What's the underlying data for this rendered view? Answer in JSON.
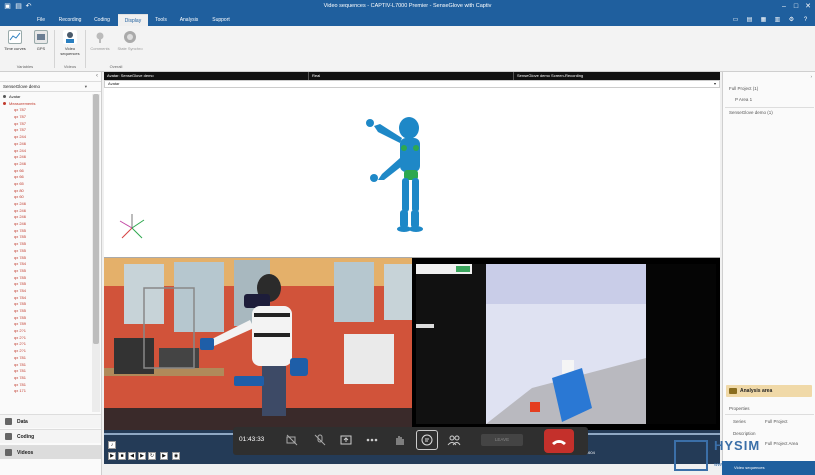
{
  "window": {
    "title": "Video sequences - CAPTIV-L7000 Premier - SenseGlove with Captiv"
  },
  "menu": {
    "tabs": [
      "File",
      "Recording",
      "Coding",
      "Display",
      "Tools",
      "Analysis",
      "Support"
    ],
    "active": "Display"
  },
  "ribbon": {
    "buttons": [
      {
        "label": "Time curves",
        "icon": "time-curves-icon"
      },
      {
        "label": "GPS",
        "icon": "gps-icon"
      },
      {
        "label": "Video sequences",
        "icon": "video-sequences-icon"
      },
      {
        "label": "Comments",
        "icon": "comments-icon"
      },
      {
        "label": "State Synchro",
        "icon": "state-synchro-icon"
      }
    ],
    "groups": [
      "Variables",
      "Videos",
      "Overall"
    ]
  },
  "left_panel": {
    "dropdown": "SenseGlove demo",
    "tree": {
      "avatar": "Avatar",
      "measurements": "Measurements",
      "items": [
        "qx 787",
        "qx 787",
        "qx 787",
        "qx 787",
        "qx 244",
        "qx 246",
        "qx 244",
        "qx 246",
        "qx 246",
        "qx 66",
        "qx 66",
        "qx 65",
        "qx 80",
        "qx 60",
        "qx 246",
        "qx 246",
        "qx 246",
        "qx 246",
        "qx 785",
        "qx 785",
        "qx 785",
        "qx 785",
        "qx 785",
        "qx 784",
        "qx 785",
        "qx 785",
        "qx 785",
        "qx 784",
        "qx 784",
        "qx 785",
        "qx 785",
        "qx 785",
        "qx 789",
        "qx 2?1",
        "qx 2?1",
        "qx 2?1",
        "qx 2?1",
        "qx 781",
        "qx 781",
        "qx 781",
        "qx 781",
        "qx 781",
        "qx 171"
      ]
    },
    "nav": [
      "Data",
      "Coding",
      "Videos"
    ]
  },
  "center": {
    "headers": [
      "Avatar: SenseGlove demo",
      "Real",
      "SenseGlove demo Screen-Recording"
    ],
    "pose_dropdown": "Avatar"
  },
  "transport": {
    "timestamp_right": "1:03:11.604",
    "playhead_position": 0.36
  },
  "meeting_bar": {
    "elapsed": "01:43:33",
    "leave_button": "LEAVE"
  },
  "right_panel": {
    "items": [
      {
        "label": "Full Project (1)"
      },
      {
        "label": "P Area 1"
      },
      {
        "label": "SenseGlove demo (1)"
      }
    ],
    "analysis_title": "Analysis area",
    "properties_title": "Properties",
    "props": [
      {
        "k": "Series",
        "v": "Full Project"
      },
      {
        "k": "Description",
        "v": "Full Project Area"
      }
    ]
  },
  "watermark": {
    "brand": "HYSIM",
    "url": "www.hysim.com.cn"
  },
  "status": {
    "text": "Video sequences"
  },
  "colors": {
    "title_bar": "#1f5f9e",
    "ribbon_bg": "#f3f3f3",
    "tree_red": "#c0392b",
    "transport": "#243b57",
    "end_call": "#c4302b",
    "avatar_body": "#1e88c7",
    "avatar_green": "#2ea84f"
  }
}
